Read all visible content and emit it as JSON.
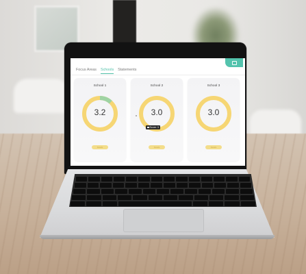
{
  "app": {
    "tabs": [
      {
        "label": "Focus Areas",
        "active": false
      },
      {
        "label": "Schools",
        "active": true
      },
      {
        "label": "Statements",
        "active": false
      }
    ],
    "header_button_icon": "layout-icon",
    "accent_color": "#4fbfa7"
  },
  "cards": [
    {
      "title": "School 1",
      "score": "3.2",
      "progress": 0.88,
      "ring_color": "#f6d674",
      "highlight_color": "#9fd3a3",
      "highlight_fraction": 0.12,
      "button_label": "Details"
    },
    {
      "title": "School 2",
      "score": "3.0",
      "progress": 1.0,
      "ring_color": "#f6d674",
      "button_label": "Details",
      "tooltip": "Score: 3"
    },
    {
      "title": "School 3",
      "score": "3.0",
      "progress": 1.0,
      "ring_color": "#f6d674",
      "button_label": "Details"
    }
  ]
}
